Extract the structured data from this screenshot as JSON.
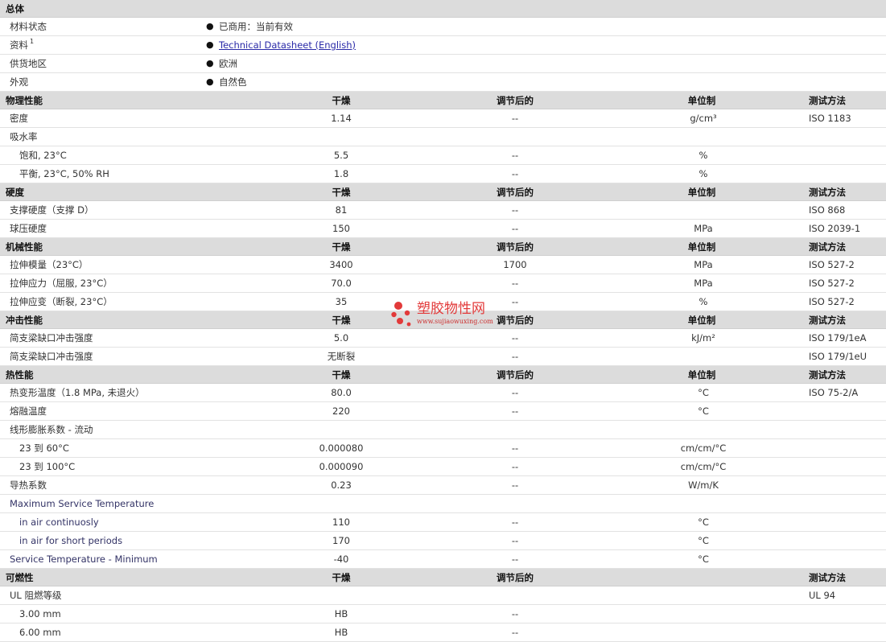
{
  "general": {
    "heading": "总体",
    "rows": [
      {
        "label": "材料状态",
        "value": "已商用：当前有效",
        "link": false
      },
      {
        "label": "资料",
        "sup": "1",
        "value": "Technical Datasheet (English)",
        "link": true
      },
      {
        "label": "供货地区",
        "value": "欧洲",
        "link": false
      },
      {
        "label": "外观",
        "value": "自然色",
        "link": false
      }
    ]
  },
  "sections": [
    {
      "name": "物理性能",
      "dry": "干燥",
      "cond": "调节后的",
      "unit": "单位制",
      "method": "测试方法",
      "rows": [
        {
          "label": "密度",
          "dry": "1.14",
          "cond": "--",
          "unit": "g/cm³",
          "method": "ISO 1183"
        },
        {
          "label": "吸水率",
          "dry": "",
          "cond": "",
          "unit": "",
          "method": ""
        },
        {
          "label": "饱和, 23°C",
          "indent": true,
          "dry": "5.5",
          "cond": "--",
          "unit": "%",
          "method": ""
        },
        {
          "label": "平衡, 23°C, 50% RH",
          "indent": true,
          "dry": "1.8",
          "cond": "--",
          "unit": "%",
          "method": ""
        }
      ]
    },
    {
      "name": "硬度",
      "dry": "干燥",
      "cond": "调节后的",
      "unit": "单位制",
      "method": "测试方法",
      "rows": [
        {
          "label": "支撑硬度（支撑 D）",
          "dry": "81",
          "cond": "--",
          "unit": "",
          "method": "ISO 868"
        },
        {
          "label": "球压硬度",
          "dry": "150",
          "cond": "--",
          "unit": "MPa",
          "method": "ISO 2039-1"
        }
      ]
    },
    {
      "name": "机械性能",
      "dry": "干燥",
      "cond": "调节后的",
      "unit": "单位制",
      "method": "测试方法",
      "rows": [
        {
          "label": "拉伸模量（23°C）",
          "dry": "3400",
          "cond": "1700",
          "unit": "MPa",
          "method": "ISO 527-2"
        },
        {
          "label": "拉伸应力（屈服, 23°C）",
          "dry": "70.0",
          "cond": "--",
          "unit": "MPa",
          "method": "ISO 527-2"
        },
        {
          "label": "拉伸应变（断裂, 23°C）",
          "dry": "35",
          "cond": "--",
          "unit": "%",
          "method": "ISO 527-2"
        }
      ]
    },
    {
      "name": "冲击性能",
      "dry": "干燥",
      "cond": "调节后的",
      "unit": "单位制",
      "method": "测试方法",
      "rows": [
        {
          "label": "简支梁缺口冲击强度",
          "dry": "5.0",
          "cond": "--",
          "unit": "kJ/m²",
          "method": "ISO 179/1eA"
        },
        {
          "label": "简支梁缺口冲击强度",
          "dry": "无断裂",
          "cond": "--",
          "unit": "",
          "method": "ISO 179/1eU"
        }
      ]
    },
    {
      "name": "热性能",
      "dry": "干燥",
      "cond": "调节后的",
      "unit": "单位制",
      "method": "测试方法",
      "rows": [
        {
          "label": "热变形温度（1.8 MPa, 未退火）",
          "dry": "80.0",
          "cond": "--",
          "unit": "°C",
          "method": "ISO 75-2/A"
        },
        {
          "label": "熔融温度",
          "dry": "220",
          "cond": "--",
          "unit": "°C",
          "method": ""
        },
        {
          "label": "线形膨胀系数  - 流动",
          "dry": "",
          "cond": "",
          "unit": "",
          "method": ""
        },
        {
          "label": "23 到   60°C",
          "indent": true,
          "dry": "0.000080",
          "cond": "--",
          "unit": "cm/cm/°C",
          "method": ""
        },
        {
          "label": "23 到   100°C",
          "indent": true,
          "dry": "0.000090",
          "cond": "--",
          "unit": "cm/cm/°C",
          "method": ""
        },
        {
          "label": "导热系数",
          "dry": "0.23",
          "cond": "--",
          "unit": "W/m/K",
          "method": ""
        },
        {
          "label": "Maximum Service Temperature",
          "en": true,
          "dry": "",
          "cond": "",
          "unit": "",
          "method": ""
        },
        {
          "label": "in air continuosly",
          "en": true,
          "indent": true,
          "dry": "110",
          "cond": "--",
          "unit": "°C",
          "method": ""
        },
        {
          "label": "in air for short periods",
          "en": true,
          "indent": true,
          "dry": "170",
          "cond": "--",
          "unit": "°C",
          "method": ""
        },
        {
          "label": "Service Temperature - Minimum",
          "en": true,
          "dry": "-40",
          "cond": "--",
          "unit": "°C",
          "method": ""
        }
      ]
    },
    {
      "name": "可燃性",
      "dry": "干燥",
      "cond": "调节后的",
      "unit": "",
      "method": "测试方法",
      "rows": [
        {
          "label": "UL 阻燃等级",
          "dry": "",
          "cond": "",
          "unit": "",
          "method": "UL 94"
        },
        {
          "label": "3.00 mm",
          "indent": true,
          "dry": "HB",
          "cond": "--",
          "unit": "",
          "method": ""
        },
        {
          "label": "6.00 mm",
          "indent": true,
          "dry": "HB",
          "cond": "--",
          "unit": "",
          "method": ""
        }
      ]
    }
  ],
  "watermark": {
    "title": "塑胶物性网",
    "url": "www.sujiaowuxing.com",
    "color": "#e23a3a"
  }
}
